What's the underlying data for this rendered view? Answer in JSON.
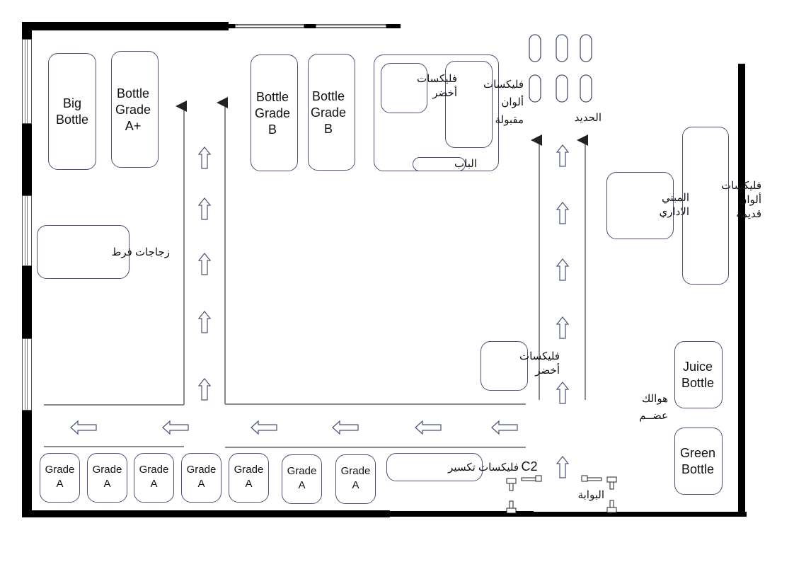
{
  "plan": {
    "type": "warehouse floor plan",
    "areas": {
      "big_bottle": "Big\nBottle",
      "bottle_grade_a_plus": "Bottle\nGrade\nA+",
      "bottle_grade_b_1": "Bottle\nGrade\nB",
      "bottle_grade_b_2": "Bottle\nGrade\nB",
      "flakes_green_top": "فليكسات\nأخضر",
      "flakes_accepted_colors": "فليكسات\nألوان\nمقبولة",
      "door": "الباب",
      "iron": "الحديد",
      "admin_building": "المبني\nالاداري",
      "flakes_old_colors": "فليكسات\nألوان\nقديمة",
      "extra_glass": "زجاجات فرط",
      "flakes_green_bottom": "فليكسات\nأخضر",
      "juice_bottle": "Juice\nBottle",
      "green_bottle": "Green\nBottle",
      "scrap_label": "هوالك\nعضــم",
      "flakes_crushing": "فليكسات تكسير",
      "c2": "C2",
      "gate": "البوابة",
      "grade_a": [
        "Grade\nA",
        "Grade\nA",
        "Grade\nA",
        "Grade\nA",
        "Grade\nA",
        "Grade\nA",
        "Grade\nA"
      ]
    },
    "icons": {
      "flow_arrow_up": "hollow-up-arrow",
      "flow_arrow_left": "hollow-left-arrow",
      "direction_line": "thin-arrow-up"
    },
    "colors": {
      "wall": "#000000",
      "box_outline": "#4a5278",
      "aisle_line": "#8a8a8a"
    }
  }
}
